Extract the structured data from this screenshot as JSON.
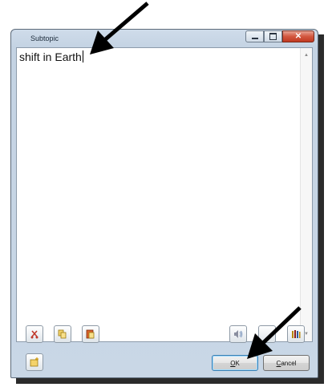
{
  "window": {
    "title": "Subtopic"
  },
  "editor": {
    "text": "shift in Earth"
  },
  "buttons": {
    "ok_accel": "O",
    "ok_rest": "K",
    "cancel_accel": "C",
    "cancel_rest": "ancel"
  },
  "colors": {
    "accent": "#3c7fb1",
    "close": "#c13a22"
  }
}
